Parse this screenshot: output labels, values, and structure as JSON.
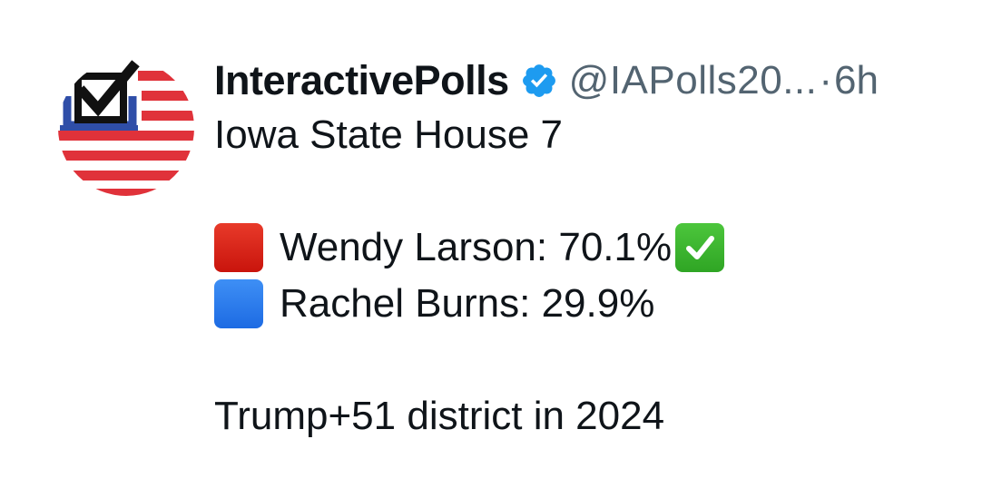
{
  "tweet": {
    "display_name": "InteractivePolls",
    "handle": "@IAPolls20...",
    "separator": "·",
    "time": "6h",
    "verified": true,
    "lines": {
      "title": "Iowa State House 7",
      "candidate_1": "Wendy Larson: 70.1%",
      "candidate_2": "Rachel Burns: 29.9%",
      "footer": "Trump+51 district in 2024"
    }
  },
  "colors": {
    "red_square": "#d91f16",
    "blue_square": "#2f7df0",
    "check_green": "#3dbb2f",
    "verified_blue": "#1d9bf0",
    "muted_text": "#536471"
  },
  "icons": {
    "avatar": "checkbox-flag-logo",
    "verified": "verified-badge-icon",
    "red_square": "red-square-emoji",
    "blue_square": "blue-square-emoji",
    "check": "check-mark-button-emoji"
  }
}
